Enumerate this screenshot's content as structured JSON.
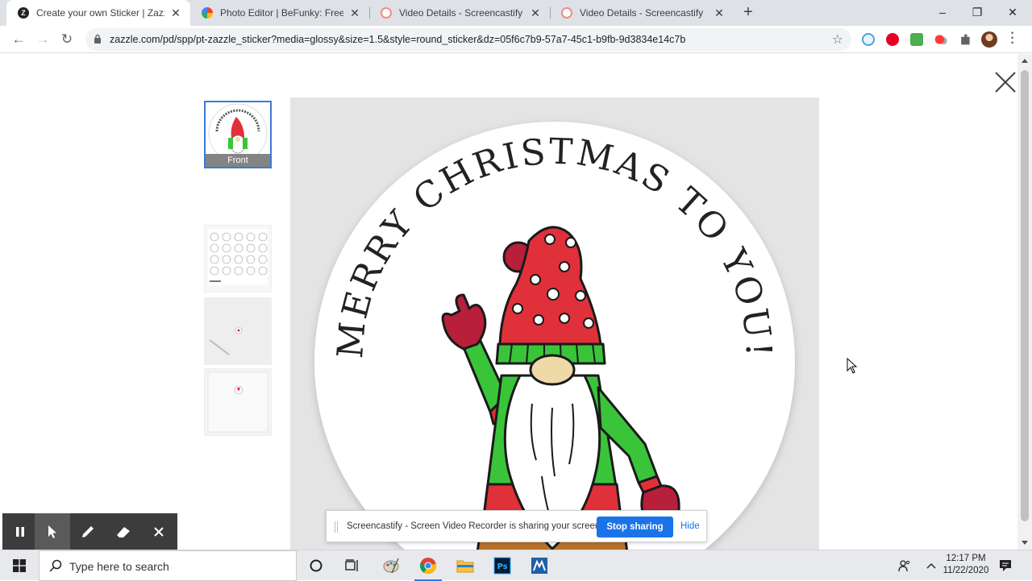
{
  "browser": {
    "tabs": [
      {
        "title": "Create your own Sticker | Zazzle.com",
        "active": true,
        "favicon": "zazzle-icon"
      },
      {
        "title": "Photo Editor | BeFunky: Free Online",
        "active": false,
        "favicon": "befunky-icon"
      },
      {
        "title": "Video Details - Screencastify",
        "active": false,
        "favicon": "screencastify-icon"
      },
      {
        "title": "Video Details - Screencastify",
        "active": false,
        "favicon": "screencastify-icon"
      }
    ],
    "new_tab_label": "+",
    "url": "zazzle.com/pd/spp/pt-zazzle_sticker?media=glossy&size=1.5&style=round_sticker&dz=05f6c7b9-57a7-45c1-b9fb-9d3834e14c7b",
    "window_controls": {
      "minimize": "–",
      "restore": "❐",
      "close": "✕"
    }
  },
  "viewer": {
    "close_icon": "close-icon",
    "thumbnails": [
      {
        "label": "Front",
        "selected": true
      },
      {
        "label": "",
        "selected": false
      },
      {
        "label": "",
        "selected": false
      },
      {
        "label": "",
        "selected": false
      }
    ],
    "sticker_text": "MERRY CHRISTMAS TO YOU!"
  },
  "screencastify": {
    "message": "Screencastify - Screen Video Recorder is sharing your screen.",
    "stop_label": "Stop sharing",
    "hide_label": "Hide"
  },
  "taskbar": {
    "search_placeholder": "Type here to search",
    "time": "12:17 PM",
    "date": "11/22/2020"
  },
  "colors": {
    "accent_blue": "#1a73e8",
    "gnome_red": "#e0303a",
    "gnome_green": "#3ac43a",
    "gnome_brown": "#b8722c"
  }
}
